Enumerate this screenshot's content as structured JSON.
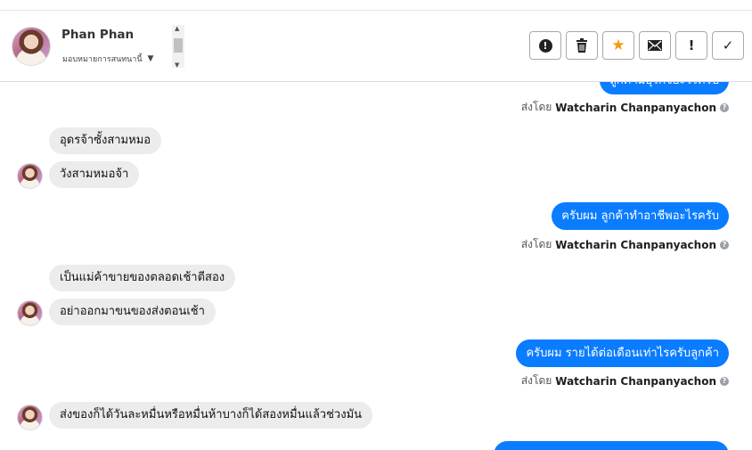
{
  "contact": {
    "name": "Phan Phan",
    "assign_label": "มอบหมายการสนทนานี้"
  },
  "toolbar": {
    "buttons": [
      "alert-icon",
      "trash-icon",
      "star-icon",
      "mail-icon",
      "exclamation-icon",
      "check-icon"
    ],
    "star_color": "#f39c12"
  },
  "messages": {
    "top_partial": "ลูกค้ามีธุรกิจอะไรครับ",
    "in_1a": "อุดรจ้าซั้งสามหมอ",
    "in_1b": "วังสามหมอจ้า",
    "out_2": "ครับผม ลูกค้าทำอาชีพอะไรครับ",
    "in_3a": "เป็นแม่ค้าขายของตลอดเช้าตีสอง",
    "in_3b": "อย่าออกมาขนของส่งตอนเช้า",
    "out_4": "ครับผม รายได้ต่อเดือนเท่าไรครับลูกค้า",
    "in_5": "ส่งของก็ได้วันละหมื่นหรือหมื่นห้าบางก็ได้สองหมื่นแล้วช่วงมัน",
    "sent_by_prefix": "ส่งโดย",
    "agent_name": "Watcharin Chanpanyachon"
  },
  "colors": {
    "outgoing": "#0a7cff",
    "incoming": "#ececec"
  }
}
